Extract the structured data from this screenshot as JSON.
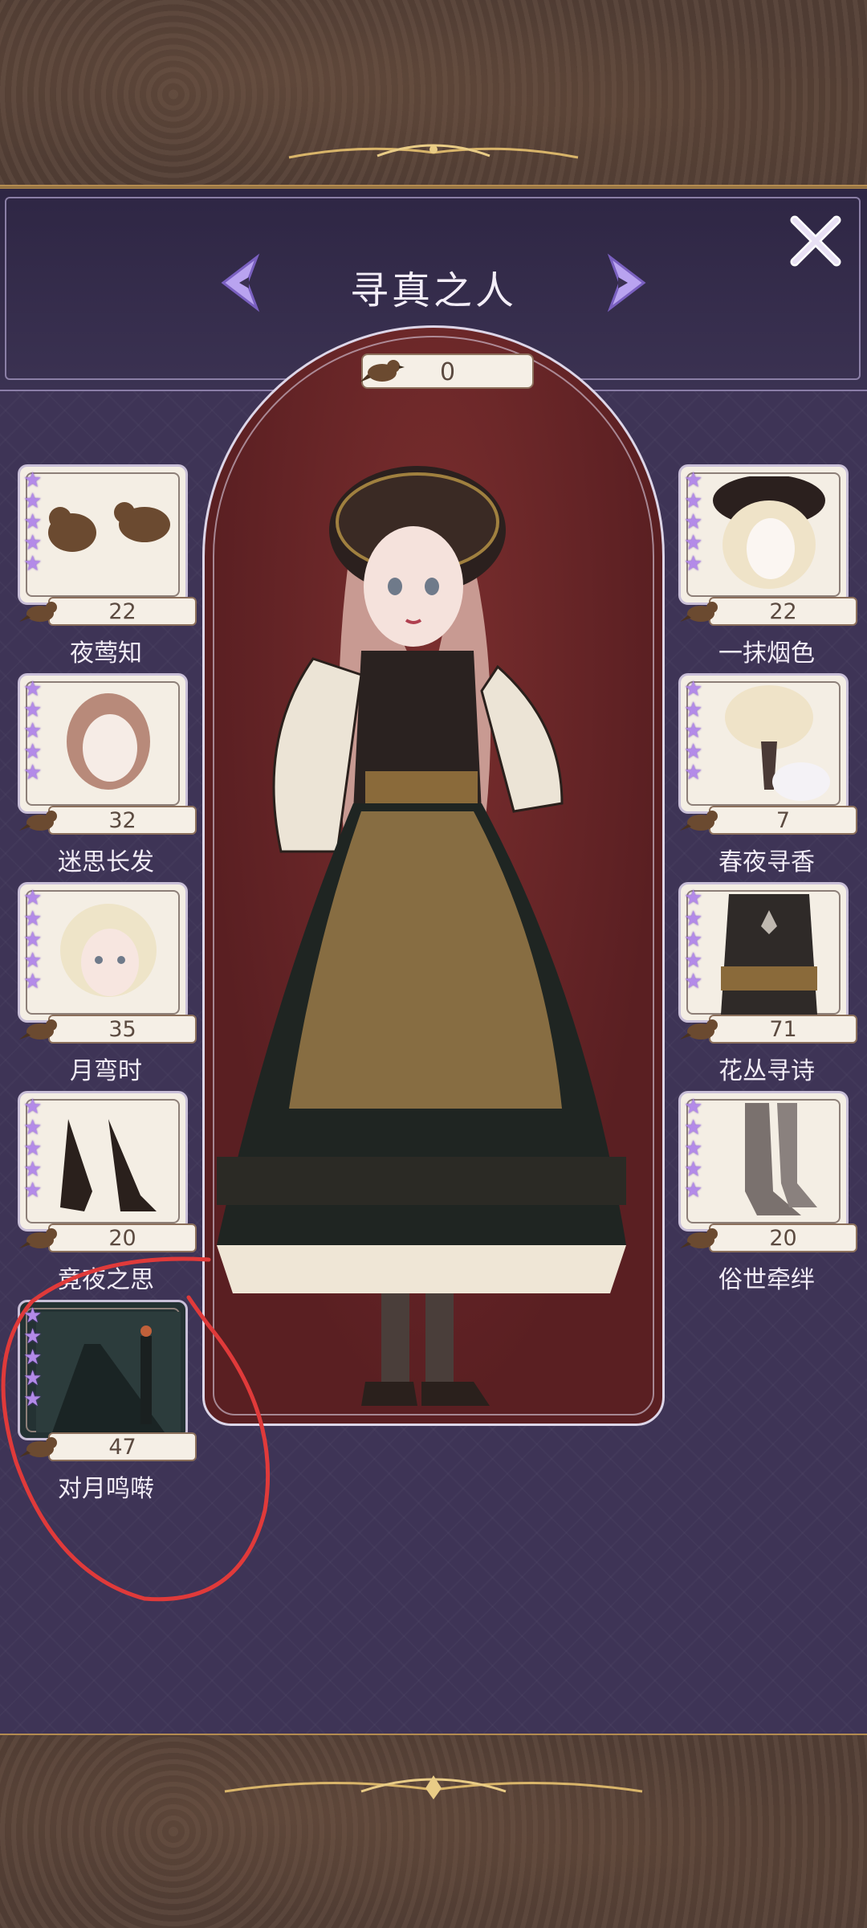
{
  "header": {
    "title": "寻真之人",
    "counter_value": "0"
  },
  "colors": {
    "panel": "#3e3456",
    "accent_purple": "#b38ae8",
    "stage_red": "#6b2629",
    "annotation_red": "#e03a3a"
  },
  "icons": {
    "prev": "chevron-left-icon",
    "next": "chevron-right-icon",
    "close": "close-icon",
    "currency": "bird-icon"
  },
  "left_items": [
    {
      "name": "夜莺知",
      "count": "22",
      "stars": 5
    },
    {
      "name": "迷思长发",
      "count": "32",
      "stars": 5
    },
    {
      "name": "月弯时",
      "count": "35",
      "stars": 5
    },
    {
      "name": "竟夜之思",
      "count": "20",
      "stars": 5
    },
    {
      "name": "对月鸣啭",
      "count": "47",
      "stars": 5
    }
  ],
  "right_items": [
    {
      "name": "一抹烟色",
      "count": "22",
      "stars": 5
    },
    {
      "name": "春夜寻香",
      "count": "7",
      "stars": 5
    },
    {
      "name": "花丛寻诗",
      "count": "71",
      "stars": 5
    },
    {
      "name": "俗世牵绊",
      "count": "20",
      "stars": 5
    }
  ]
}
